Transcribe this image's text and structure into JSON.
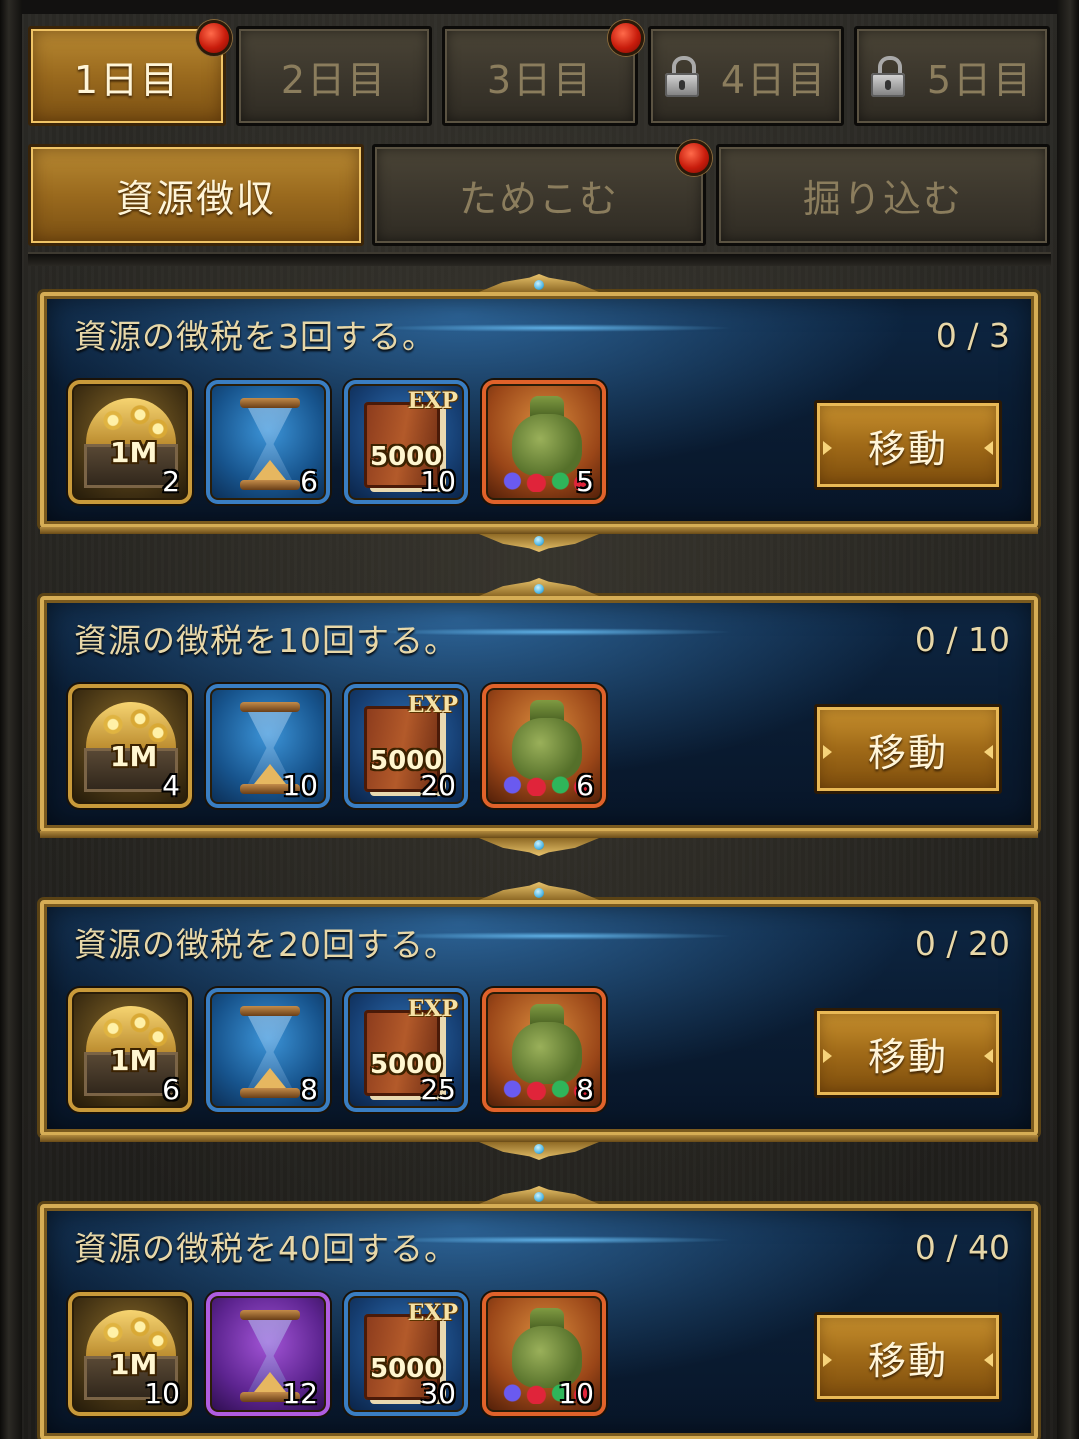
{
  "day_tabs": [
    {
      "label": "1日目",
      "active": true,
      "locked": false,
      "badge": true
    },
    {
      "label": "2日目",
      "active": false,
      "locked": false,
      "badge": false
    },
    {
      "label": "3日目",
      "active": false,
      "locked": false,
      "badge": true
    },
    {
      "label": "4日目",
      "active": false,
      "locked": true,
      "badge": false
    },
    {
      "label": "5日目",
      "active": false,
      "locked": true,
      "badge": false
    }
  ],
  "category_tabs": [
    {
      "label": "資源徴収",
      "active": true,
      "badge": false
    },
    {
      "label": "ためこむ",
      "active": false,
      "badge": true
    },
    {
      "label": "掘り込む",
      "active": false,
      "badge": false
    }
  ],
  "quests": [
    {
      "title": "資源の徴税を3回する。",
      "progress": "0 / 3",
      "button_label": "移動",
      "rewards": [
        {
          "type": "gold-chest",
          "icon": "gold-chest-icon",
          "chip": "1M",
          "qty": "2"
        },
        {
          "type": "speedup",
          "icon": "hourglass-icon",
          "qty": "6"
        },
        {
          "type": "exp-book",
          "icon": "exp-book-icon",
          "tag": "EXP",
          "chip": "5000",
          "qty": "10"
        },
        {
          "type": "gem-bag",
          "icon": "gem-bag-icon",
          "qty": "5"
        }
      ]
    },
    {
      "title": "資源の徴税を10回する。",
      "progress": "0 / 10",
      "button_label": "移動",
      "rewards": [
        {
          "type": "gold-chest",
          "icon": "gold-chest-icon",
          "chip": "1M",
          "qty": "4"
        },
        {
          "type": "speedup",
          "icon": "hourglass-icon",
          "qty": "10"
        },
        {
          "type": "exp-book",
          "icon": "exp-book-icon",
          "tag": "EXP",
          "chip": "5000",
          "qty": "20"
        },
        {
          "type": "gem-bag",
          "icon": "gem-bag-icon",
          "qty": "6"
        }
      ]
    },
    {
      "title": "資源の徴税を20回する。",
      "progress": "0 / 20",
      "button_label": "移動",
      "rewards": [
        {
          "type": "gold-chest",
          "icon": "gold-chest-icon",
          "chip": "1M",
          "qty": "6"
        },
        {
          "type": "speedup",
          "icon": "hourglass-icon",
          "qty": "8"
        },
        {
          "type": "exp-book",
          "icon": "exp-book-icon",
          "tag": "EXP",
          "chip": "5000",
          "qty": "25"
        },
        {
          "type": "gem-bag",
          "icon": "gem-bag-icon",
          "qty": "8"
        }
      ]
    },
    {
      "title": "資源の徴税を40回する。",
      "progress": "0 / 40",
      "button_label": "移動",
      "rewards": [
        {
          "type": "gold-chest",
          "icon": "gold-chest-icon",
          "chip": "1M",
          "qty": "10"
        },
        {
          "type": "speedup-epic",
          "icon": "hourglass-purple-icon",
          "qty": "12"
        },
        {
          "type": "exp-book",
          "icon": "exp-book-icon",
          "tag": "EXP",
          "chip": "5000",
          "qty": "30"
        },
        {
          "type": "gem-bag",
          "icon": "gem-bag-icon",
          "qty": "10"
        }
      ]
    }
  ],
  "colors": {
    "active_tab": "#a06a18",
    "inactive_tab": "#3b362c",
    "card_bg": "#0a1d34",
    "card_border": "#d6ad55",
    "badge": "#c81c0c"
  }
}
